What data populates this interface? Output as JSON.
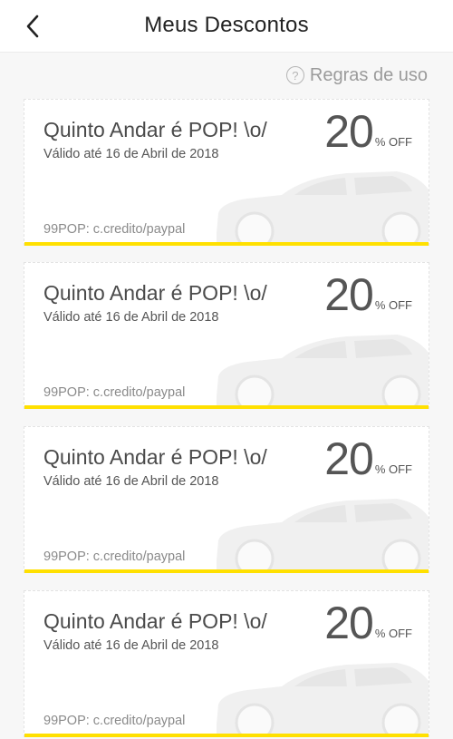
{
  "header": {
    "title": "Meus Descontos",
    "back_icon": "chevron-left-icon"
  },
  "rules": {
    "icon_glyph": "?",
    "label": "Regras de uso"
  },
  "colors": {
    "accent": "#ffe000",
    "car_silhouette": "#f0f0f0"
  },
  "coupons": [
    {
      "title": "Quinto Andar é POP! \\o/",
      "validity": "Válido até 16 de Abril de 2018",
      "code": "99POP: c.credito/paypal",
      "discount_value": "20",
      "discount_suffix": "% OFF"
    },
    {
      "title": "Quinto Andar é POP! \\o/",
      "validity": "Válido até 16 de Abril de 2018",
      "code": "99POP: c.credito/paypal",
      "discount_value": "20",
      "discount_suffix": "% OFF"
    },
    {
      "title": "Quinto Andar é POP! \\o/",
      "validity": "Válido até 16 de Abril de 2018",
      "code": "99POP: c.credito/paypal",
      "discount_value": "20",
      "discount_suffix": "% OFF"
    },
    {
      "title": "Quinto Andar é POP! \\o/",
      "validity": "Válido até 16 de Abril de 2018",
      "code": "99POP: c.credito/paypal",
      "discount_value": "20",
      "discount_suffix": "% OFF"
    }
  ]
}
